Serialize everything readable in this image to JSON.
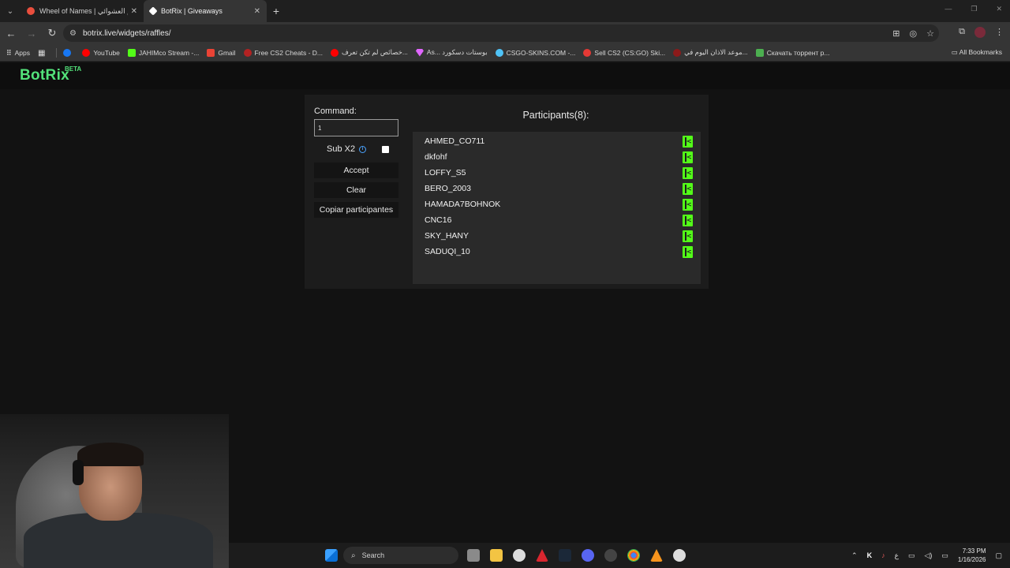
{
  "browser": {
    "tabs": [
      {
        "title": "Wheel of Names | اسم العشوائي",
        "active": false,
        "favicon_color": "#e94e3d"
      },
      {
        "title": "BotRix | Giveaways",
        "active": true,
        "favicon_color": "#ffffff"
      }
    ],
    "new_tab_label": "+",
    "address": "botrix.live/widgets/raffles/",
    "bookmarks": [
      {
        "label": "Apps",
        "color": "#ffffff"
      },
      {
        "label": "",
        "color": "#3d5afe"
      },
      {
        "label": "YouTube",
        "color": "#ff0000"
      },
      {
        "label": "JAHIMco Stream -...",
        "color": "#53fc18"
      },
      {
        "label": "Gmail",
        "color": "#ea4335"
      },
      {
        "label": "Free CS2 Cheats - D...",
        "color": "#b22222"
      },
      {
        "label": "خصائص لم تكن تعرف...",
        "color": "#ff0000"
      },
      {
        "label": "As... بوستات دسكورد",
        "color": "#e066ff"
      },
      {
        "label": "CSGO-SKINS.COM -...",
        "color": "#4fc3f7"
      },
      {
        "label": "Sell CS2 (CS:GO) Ski...",
        "color": "#e53935"
      },
      {
        "label": "موعد الاذان اليوم في...",
        "color": "#8b1a1a"
      },
      {
        "label": "Скачать торрент р...",
        "color": "#4caf50"
      }
    ],
    "all_bookmarks_label": "All Bookmarks"
  },
  "site": {
    "logo": "BotRix",
    "logo_badge": "BETA",
    "accent_color": "#53e27a"
  },
  "raffle": {
    "command_label": "Command:",
    "command_value": "1",
    "sub_label": "Sub X2",
    "info_icon_glyph": "i",
    "sub_checked": false,
    "accept_label": "Accept",
    "clear_label": "Clear",
    "copy_label": "Copiar participantes",
    "participants_title": "Participants(8):",
    "participants": [
      {
        "name": "AHMED_CO711",
        "platform": "kick"
      },
      {
        "name": "dkfohf",
        "platform": "kick"
      },
      {
        "name": "LOFFY_S5",
        "platform": "kick"
      },
      {
        "name": "BERO_2003",
        "platform": "kick"
      },
      {
        "name": "HAMADA7BOHNOK",
        "platform": "kick"
      },
      {
        "name": "CNC16",
        "platform": "kick"
      },
      {
        "name": "SKY_HANY",
        "platform": "kick"
      },
      {
        "name": "SADUQI_10",
        "platform": "kick"
      }
    ]
  },
  "taskbar": {
    "search_label": "Search",
    "language": "ع",
    "time": "7:33 PM",
    "date": "1/16/2026"
  }
}
